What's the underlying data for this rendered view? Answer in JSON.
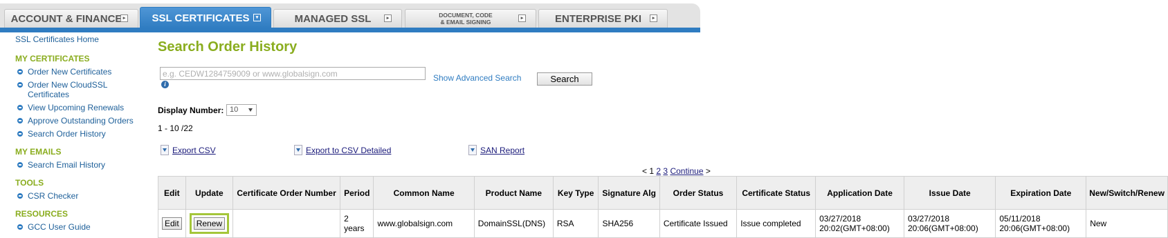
{
  "tabs": [
    {
      "label": "ACCOUNT & FINANCE",
      "active": false
    },
    {
      "label": "SSL CERTIFICATES",
      "active": true
    },
    {
      "label": "MANAGED SSL",
      "active": false
    },
    {
      "label_line1": "DOCUMENT, CODE",
      "label_line2": "& EMAIL SIGNING",
      "active": false
    },
    {
      "label": "ENTERPRISE PKI",
      "active": false
    }
  ],
  "sidebar": {
    "home": "SSL Certificates Home",
    "sections": [
      {
        "heading": "MY CERTIFICATES",
        "items": [
          "Order New Certificates",
          "Order New CloudSSL Certificates",
          "View Upcoming Renewals",
          "Approve Outstanding Orders",
          "Search Order History"
        ]
      },
      {
        "heading": "MY EMAILS",
        "items": [
          "Search Email History"
        ]
      },
      {
        "heading": "TOOLS",
        "items": [
          "CSR Checker"
        ]
      },
      {
        "heading": "RESOURCES",
        "items": [
          "GCC User Guide"
        ]
      }
    ]
  },
  "main": {
    "title": "Search Order History",
    "search_placeholder": "e.g. CEDW1284759009 or www.globalsign.com",
    "advanced_link": "Show Advanced Search",
    "search_button": "Search",
    "display_label": "Display Number:",
    "display_value": "10",
    "range_text": "1 - 10 /22",
    "exports": [
      "Export CSV",
      "Export to CSV Detailed",
      "SAN Report"
    ],
    "pager": {
      "prev": "<",
      "current": "1",
      "pages": [
        "2",
        "3"
      ],
      "continue": "Continue",
      "next": ">"
    }
  },
  "table": {
    "headers": [
      "Edit",
      "Update",
      "Certificate Order Number",
      "Period",
      "Common Name",
      "Product Name",
      "Key Type",
      "Signature Alg",
      "Order Status",
      "Certificate Status",
      "Application Date",
      "Issue Date",
      "Expiration Date",
      "New/Switch/Renew"
    ],
    "row": {
      "edit": "Edit",
      "update": "Renew",
      "order_number": "",
      "period": "2 years",
      "common_name": "www.globalsign.com",
      "product_name": "DomainSSL(DNS)",
      "key_type": "RSA",
      "signature_alg": "SHA256",
      "order_status": "Certificate Issued",
      "certificate_status": "Issue completed",
      "application_date": "03/27/2018 20:02(GMT+08:00)",
      "issue_date": "03/27/2018 20:06(GMT+08:00)",
      "expiration_date": "05/11/2018 20:06(GMT+08:00)",
      "new_switch_renew": "New"
    }
  },
  "colors": {
    "accent_blue": "#2f7cc1",
    "title_green": "#8aad1f",
    "highlight": "#a4c639"
  }
}
